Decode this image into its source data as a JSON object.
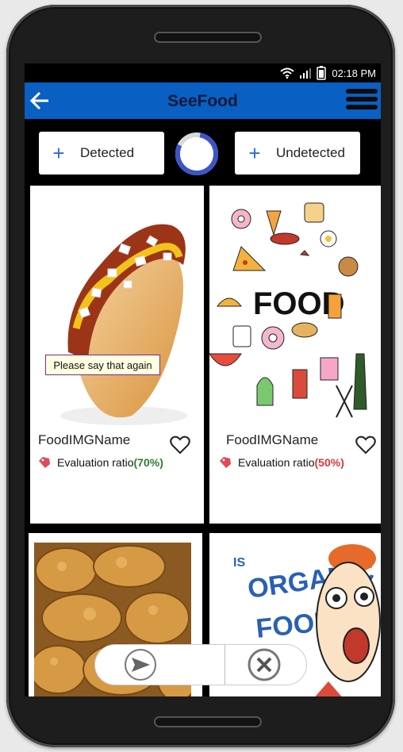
{
  "status_bar": {
    "time": "02:18 PM",
    "icons": [
      "wifi-icon",
      "signal-icon",
      "battery-icon"
    ]
  },
  "app_bar": {
    "title": "SeeFood",
    "back_icon": "back-arrow-icon",
    "menu_icon": "hamburger-menu-icon"
  },
  "filters": {
    "detected_label": "Detected",
    "undetected_label": "Undetected",
    "plus_symbol": "+"
  },
  "tooltip": {
    "text": "Please say that again"
  },
  "cards": [
    {
      "name": "FoodIMGName",
      "ratio_label": "Evaluation ratio",
      "ratio_value": "(70%)",
      "image": "hot-dog-image"
    },
    {
      "name": "FoodIMGName",
      "ratio_label": "Evaluation ratio",
      "ratio_value": "(50%)",
      "image": "food-doodle-image"
    },
    {
      "image": "fried-chicken-image"
    },
    {
      "image": "organic-food-cartoon-image",
      "image_text": [
        "IS",
        "ORGANIC",
        "FOOD"
      ]
    }
  ],
  "colors": {
    "app_bar": "#0a5fc2",
    "accent_plus": "#2a6be0",
    "ratio_good": "#2e7d32",
    "ratio_mid": "#d43a3a",
    "spinner": "#3d54c9"
  },
  "actions": {
    "send_icon": "send-icon",
    "close_icon": "close-circle-icon"
  }
}
